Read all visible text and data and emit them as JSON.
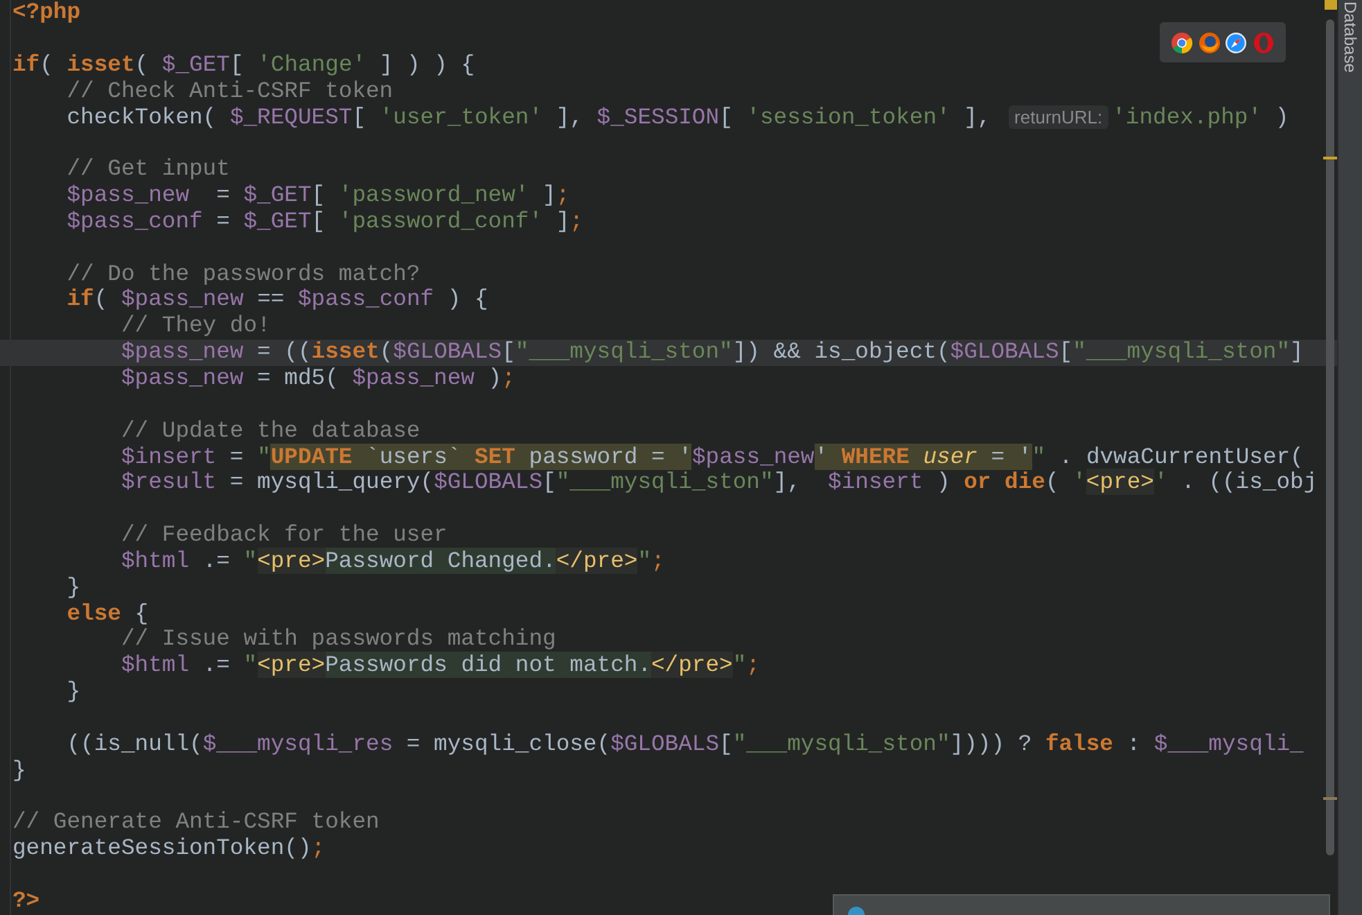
{
  "editor": {
    "lines": [
      {
        "current": false,
        "tokens": [
          {
            "kind": "kw",
            "text": "<?php"
          }
        ]
      },
      {
        "current": false
      },
      {
        "current": false,
        "tokens": [
          {
            "kind": "kw",
            "text": "if"
          },
          {
            "kind": "txt",
            "text": "( "
          },
          {
            "kind": "kw",
            "text": "isset"
          },
          {
            "kind": "txt",
            "text": "( "
          },
          {
            "kind": "var",
            "text": "$_GET"
          },
          {
            "kind": "txt",
            "text": "[ "
          },
          {
            "kind": "str",
            "text": "'Change'"
          },
          {
            "kind": "txt",
            "text": " ] ) ) {"
          }
        ]
      },
      {
        "current": false,
        "tokens": [
          {
            "kind": "cmt",
            "text": "    // Check Anti-CSRF token"
          }
        ]
      },
      {
        "current": false,
        "tokens": [
          {
            "kind": "txt",
            "text": "    checkToken( "
          },
          {
            "kind": "var",
            "text": "$_REQUEST"
          },
          {
            "kind": "txt",
            "text": "[ "
          },
          {
            "kind": "str",
            "text": "'user_token'"
          },
          {
            "kind": "txt",
            "text": " ], "
          },
          {
            "kind": "var",
            "text": "$_SESSION"
          },
          {
            "kind": "txt",
            "text": "[ "
          },
          {
            "kind": "str",
            "text": "'session_token'"
          },
          {
            "kind": "txt",
            "text": " ], "
          },
          {
            "kind": "hint",
            "text": "returnURL:"
          },
          {
            "kind": "str",
            "text": "'index.php'"
          },
          {
            "kind": "txt",
            "text": " )"
          }
        ]
      },
      {
        "current": false
      },
      {
        "current": false,
        "tokens": [
          {
            "kind": "cmt",
            "text": "    // Get input"
          }
        ]
      },
      {
        "current": false,
        "tokens": [
          {
            "kind": "var",
            "text": "    $pass_new"
          },
          {
            "kind": "txt",
            "text": "  = "
          },
          {
            "kind": "var",
            "text": "$_GET"
          },
          {
            "kind": "txt",
            "text": "[ "
          },
          {
            "kind": "str",
            "text": "'password_new'"
          },
          {
            "kind": "txt",
            "text": " ]"
          },
          {
            "kind": "semi",
            "text": ";"
          }
        ]
      },
      {
        "current": false,
        "tokens": [
          {
            "kind": "var",
            "text": "    $pass_conf"
          },
          {
            "kind": "txt",
            "text": " = "
          },
          {
            "kind": "var",
            "text": "$_GET"
          },
          {
            "kind": "txt",
            "text": "[ "
          },
          {
            "kind": "str",
            "text": "'password_conf'"
          },
          {
            "kind": "txt",
            "text": " ]"
          },
          {
            "kind": "semi",
            "text": ";"
          }
        ]
      },
      {
        "current": false
      },
      {
        "current": false,
        "tokens": [
          {
            "kind": "cmt",
            "text": "    // Do the passwords match?"
          }
        ]
      },
      {
        "current": false,
        "tokens": [
          {
            "kind": "kw",
            "text": "    if"
          },
          {
            "kind": "txt",
            "text": "( "
          },
          {
            "kind": "var",
            "text": "$pass_new"
          },
          {
            "kind": "txt",
            "text": " == "
          },
          {
            "kind": "var",
            "text": "$pass_conf"
          },
          {
            "kind": "txt",
            "text": " ) {"
          }
        ]
      },
      {
        "current": false,
        "tokens": [
          {
            "kind": "cmt",
            "text": "        // They do!"
          }
        ]
      },
      {
        "current": true,
        "tokens": [
          {
            "kind": "var",
            "text": "        $pass_new"
          },
          {
            "kind": "txt",
            "text": " = (("
          },
          {
            "kind": "kw",
            "text": "isset"
          },
          {
            "kind": "txt",
            "text": "("
          },
          {
            "kind": "var",
            "text": "$GLOBALS"
          },
          {
            "kind": "txt",
            "text": "["
          },
          {
            "kind": "str",
            "text": "\"___mysqli_ston\""
          },
          {
            "kind": "txt",
            "text": "]) && is_object("
          },
          {
            "kind": "var",
            "text": "$GLOBALS"
          },
          {
            "kind": "txt",
            "text": "["
          },
          {
            "kind": "str",
            "text": "\"___mysqli_ston\""
          },
          {
            "kind": "txt",
            "text": "]"
          }
        ]
      },
      {
        "current": false,
        "tokens": [
          {
            "kind": "var",
            "text": "        $pass_new"
          },
          {
            "kind": "txt",
            "text": " = md5( "
          },
          {
            "kind": "var",
            "text": "$pass_new"
          },
          {
            "kind": "txt",
            "text": " )"
          },
          {
            "kind": "semi",
            "text": ";"
          }
        ]
      },
      {
        "current": false
      },
      {
        "current": false,
        "tokens": [
          {
            "kind": "cmt",
            "text": "        // Update the database"
          }
        ]
      },
      {
        "current": false,
        "tokens": [
          {
            "kind": "var",
            "text": "        $insert"
          },
          {
            "kind": "txt",
            "text": " = "
          },
          {
            "kind": "str",
            "text": "\""
          },
          {
            "kind": "sqlkw",
            "text": "UPDATE"
          },
          {
            "kind": "sqltxt",
            "text": " `users` "
          },
          {
            "kind": "sqlkw",
            "text": "SET"
          },
          {
            "kind": "sqltxt",
            "text": " password = '"
          },
          {
            "kind": "var",
            "text": "$pass_new"
          },
          {
            "kind": "sqltxt",
            "text": "' "
          },
          {
            "kind": "sqlkw",
            "text": "WHERE "
          },
          {
            "kind": "sqlcol",
            "text": "user"
          },
          {
            "kind": "sqltxt",
            "text": " = '"
          },
          {
            "kind": "str",
            "text": "\""
          },
          {
            "kind": "txt",
            "text": " . dvwaCurrentUser("
          }
        ]
      },
      {
        "current": false,
        "tokens": [
          {
            "kind": "var",
            "text": "        $result"
          },
          {
            "kind": "txt",
            "text": " = mysqli_query("
          },
          {
            "kind": "var",
            "text": "$GLOBALS"
          },
          {
            "kind": "txt",
            "text": "["
          },
          {
            "kind": "str",
            "text": "\"___mysqli_ston\""
          },
          {
            "kind": "txt",
            "text": "],  "
          },
          {
            "kind": "var",
            "text": "$insert"
          },
          {
            "kind": "txt",
            "text": " ) "
          },
          {
            "kind": "kw",
            "text": "or"
          },
          {
            "kind": "kw",
            "text": " die"
          },
          {
            "kind": "txt",
            "text": "( "
          },
          {
            "kind": "str",
            "text": "'"
          },
          {
            "kind": "tag",
            "text": "<pre>"
          },
          {
            "kind": "str",
            "text": "'"
          },
          {
            "kind": "txt",
            "text": " . ((is_obj"
          }
        ]
      },
      {
        "current": false
      },
      {
        "current": false,
        "tokens": [
          {
            "kind": "cmt",
            "text": "        // Feedback for the user"
          }
        ]
      },
      {
        "current": false,
        "tokens": [
          {
            "kind": "var",
            "text": "        $html"
          },
          {
            "kind": "txt",
            "text": " .= "
          },
          {
            "kind": "str",
            "text": "\""
          },
          {
            "kind": "tag",
            "text": "<pre>"
          },
          {
            "kind": "htxt",
            "text": "Password Changed."
          },
          {
            "kind": "tag",
            "text": "</pre>"
          },
          {
            "kind": "str",
            "text": "\""
          },
          {
            "kind": "semi",
            "text": ";"
          }
        ]
      },
      {
        "current": false,
        "tokens": [
          {
            "kind": "txt",
            "text": "    }"
          }
        ]
      },
      {
        "current": false,
        "tokens": [
          {
            "kind": "kw",
            "text": "    else"
          },
          {
            "kind": "txt",
            "text": " {"
          }
        ]
      },
      {
        "current": false,
        "tokens": [
          {
            "kind": "cmt",
            "text": "        // Issue with passwords matching"
          }
        ]
      },
      {
        "current": false,
        "tokens": [
          {
            "kind": "var",
            "text": "        $html"
          },
          {
            "kind": "txt",
            "text": " .= "
          },
          {
            "kind": "str",
            "text": "\""
          },
          {
            "kind": "tag",
            "text": "<pre>"
          },
          {
            "kind": "htxt",
            "text": "Passwords did not match."
          },
          {
            "kind": "tag",
            "text": "</pre>"
          },
          {
            "kind": "str",
            "text": "\""
          },
          {
            "kind": "semi",
            "text": ";"
          }
        ]
      },
      {
        "current": false,
        "tokens": [
          {
            "kind": "txt",
            "text": "    }"
          }
        ]
      },
      {
        "current": false
      },
      {
        "current": false,
        "tokens": [
          {
            "kind": "txt",
            "text": "    ((is_null("
          },
          {
            "kind": "var",
            "text": "$___mysqli_res"
          },
          {
            "kind": "txt",
            "text": " = mysqli_close("
          },
          {
            "kind": "var",
            "text": "$GLOBALS"
          },
          {
            "kind": "txt",
            "text": "["
          },
          {
            "kind": "str",
            "text": "\"___mysqli_ston\""
          },
          {
            "kind": "txt",
            "text": "]))) ? "
          },
          {
            "kind": "kw",
            "text": "false"
          },
          {
            "kind": "txt",
            "text": " : "
          },
          {
            "kind": "var",
            "text": "$___mysqli_"
          }
        ]
      },
      {
        "current": false,
        "tokens": [
          {
            "kind": "txt",
            "text": "}"
          }
        ]
      },
      {
        "current": false
      },
      {
        "current": false,
        "tokens": [
          {
            "kind": "cmt",
            "text": "// Generate Anti-CSRF token"
          }
        ]
      },
      {
        "current": false,
        "tokens": [
          {
            "kind": "txt",
            "text": "generateSessionToken()"
          },
          {
            "kind": "semi",
            "text": ";"
          }
        ]
      },
      {
        "current": false
      },
      {
        "current": false,
        "tokens": [
          {
            "kind": "kw",
            "text": "?>"
          }
        ]
      }
    ]
  },
  "right_toolbar": {
    "tab": "Database"
  }
}
